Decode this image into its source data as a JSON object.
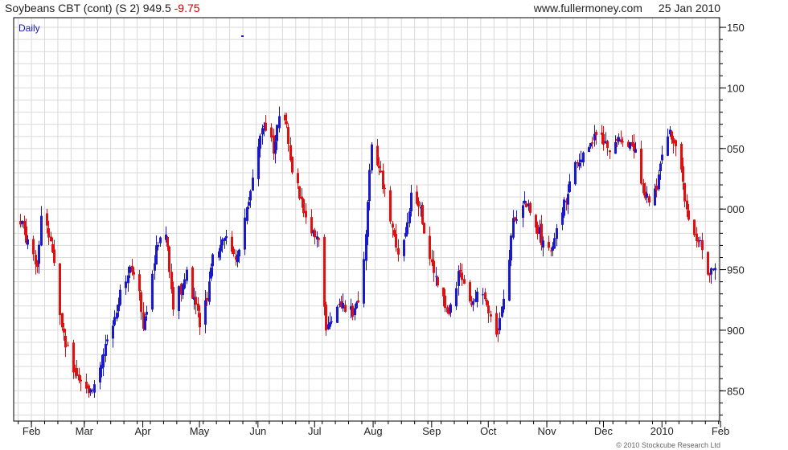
{
  "header": {
    "instrument": "Soybeans CBT (cont) (S 2)",
    "last": "949.5",
    "change": "-9.75",
    "site": "www.fullermoney.com",
    "date": "25 Jan 2010"
  },
  "footer": {
    "credit": "© 2010 Stockcube Research Ltd"
  },
  "panel_label": "Daily",
  "colors": {
    "up": "#1a1acc",
    "down": "#e01010",
    "grid": "#d9d9d9",
    "frame": "#000000"
  },
  "chart_data": {
    "type": "ohlc-candlestick",
    "frequency": "daily",
    "x_range": [
      "2009-01-26",
      "2010-01-29"
    ],
    "ylim": [
      825,
      1158
    ],
    "y_ticks": [
      850,
      900,
      950,
      1000,
      1050,
      1100,
      1150
    ],
    "y_tick_labels": [
      "850",
      "900",
      "950",
      "000",
      "050",
      "100",
      "150"
    ],
    "x_ticks": [
      {
        "date": "2009-02-01",
        "label": "Feb"
      },
      {
        "date": "2009-03-01",
        "label": "Mar"
      },
      {
        "date": "2009-04-01",
        "label": "Apr"
      },
      {
        "date": "2009-05-01",
        "label": "May"
      },
      {
        "date": "2009-06-01",
        "label": "Jun"
      },
      {
        "date": "2009-07-01",
        "label": "Jul"
      },
      {
        "date": "2009-08-01",
        "label": "Aug"
      },
      {
        "date": "2009-09-01",
        "label": "Sep"
      },
      {
        "date": "2009-10-01",
        "label": "Oct"
      },
      {
        "date": "2009-11-01",
        "label": "Nov"
      },
      {
        "date": "2009-12-01",
        "label": "Dec"
      },
      {
        "date": "2010-01-01",
        "label": "2010"
      },
      {
        "date": "2010-02-01",
        "label": "Feb"
      }
    ],
    "grid": true,
    "close_path": [
      [
        "2009-01-26",
        990
      ],
      [
        "2009-02-04",
        950
      ],
      [
        "2009-02-07",
        1010
      ],
      [
        "2009-02-13",
        950
      ],
      [
        "2009-02-17",
        900
      ],
      [
        "2009-02-24",
        865
      ],
      [
        "2009-03-01",
        845
      ],
      [
        "2009-03-07",
        860
      ],
      [
        "2009-03-12",
        885
      ],
      [
        "2009-03-18",
        920
      ],
      [
        "2009-03-25",
        950
      ],
      [
        "2009-03-30",
        930
      ],
      [
        "2009-04-01",
        900
      ],
      [
        "2009-04-06",
        950
      ],
      [
        "2009-04-12",
        995
      ],
      [
        "2009-04-17",
        920
      ],
      [
        "2009-04-24",
        945
      ],
      [
        "2009-05-02",
        900
      ],
      [
        "2009-05-08",
        960
      ],
      [
        "2009-05-14",
        975
      ],
      [
        "2009-05-21",
        960
      ],
      [
        "2009-05-28",
        1020
      ],
      [
        "2009-06-04",
        1070
      ],
      [
        "2009-06-09",
        1050
      ],
      [
        "2009-06-14",
        1090
      ],
      [
        "2009-06-18",
        1040
      ],
      [
        "2009-06-23",
        1010
      ],
      [
        "2009-06-27",
        985
      ],
      [
        "2009-07-03",
        970
      ],
      [
        "2009-07-07",
        905
      ],
      [
        "2009-07-13",
        920
      ],
      [
        "2009-07-21",
        915
      ],
      [
        "2009-07-26",
        935
      ],
      [
        "2009-07-31",
        1050
      ],
      [
        "2009-08-05",
        1030
      ],
      [
        "2009-08-11",
        980
      ],
      [
        "2009-08-15",
        960
      ],
      [
        "2009-08-21",
        1010
      ],
      [
        "2009-08-26",
        1000
      ],
      [
        "2009-08-30",
        960
      ],
      [
        "2009-09-04",
        940
      ],
      [
        "2009-09-10",
        910
      ],
      [
        "2009-09-16",
        950
      ],
      [
        "2009-09-21",
        920
      ],
      [
        "2009-09-27",
        930
      ],
      [
        "2009-10-02",
        915
      ],
      [
        "2009-10-06",
        895
      ],
      [
        "2009-10-11",
        945
      ],
      [
        "2009-10-14",
        990
      ],
      [
        "2009-10-20",
        1005
      ],
      [
        "2009-10-26",
        990
      ],
      [
        "2009-10-31",
        965
      ],
      [
        "2009-11-05",
        975
      ],
      [
        "2009-11-11",
        1010
      ],
      [
        "2009-11-16",
        1040
      ],
      [
        "2009-11-22",
        1050
      ],
      [
        "2009-11-27",
        1060
      ],
      [
        "2009-12-01",
        1055
      ],
      [
        "2009-12-06",
        1050
      ],
      [
        "2009-12-12",
        1060
      ],
      [
        "2009-12-18",
        1045
      ],
      [
        "2009-12-23",
        1010
      ],
      [
        "2009-12-27",
        1005
      ],
      [
        "2010-01-01",
        1045
      ],
      [
        "2010-01-05",
        1065
      ],
      [
        "2010-01-10",
        1040
      ],
      [
        "2010-01-14",
        1000
      ],
      [
        "2010-01-20",
        975
      ],
      [
        "2010-01-25",
        949.5
      ]
    ],
    "daily_volatility": 7,
    "extremes": {
      "high": 1106,
      "low": 842
    }
  }
}
